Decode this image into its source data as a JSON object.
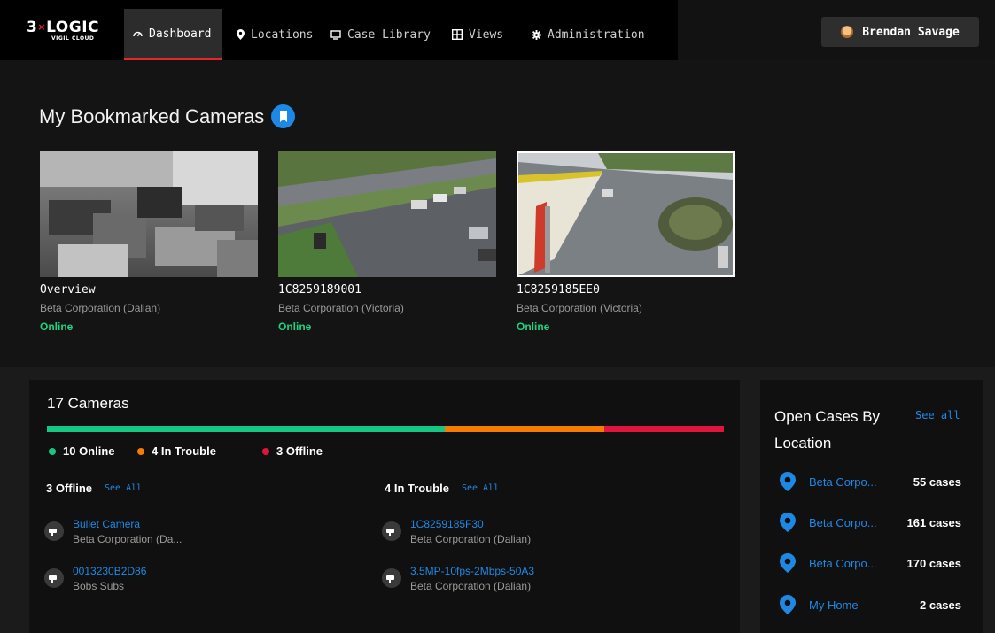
{
  "brand": {
    "logo_main": "3×LOGIC",
    "logo_sub": "VIGIL CLOUD"
  },
  "nav": {
    "items": [
      {
        "label": "Dashboard",
        "icon": "dashboard-icon",
        "active": true
      },
      {
        "label": "Locations",
        "icon": "map-pin-icon"
      },
      {
        "label": "Case Library",
        "icon": "monitor-icon"
      },
      {
        "label": "Views",
        "icon": "grid-icon"
      },
      {
        "label": "Administration",
        "icon": "gear-icon"
      }
    ],
    "user": {
      "name": "Brendan Savage",
      "icon": "avatar"
    }
  },
  "bookmarks": {
    "title": "My Bookmarked Cameras",
    "icon": "bookmark-icon",
    "cameras": [
      {
        "name": "Overview",
        "location": "Beta Corporation (Dalian)",
        "status": "Online"
      },
      {
        "name": "1C8259189001",
        "location": "Beta Corporation (Victoria)",
        "status": "Online"
      },
      {
        "name": "1C8259185EE0",
        "location": "Beta Corporation (Victoria)",
        "status": "Online",
        "selected": true
      }
    ]
  },
  "cameras_summary": {
    "title": "17 Cameras",
    "status_bar": [
      {
        "status": "online",
        "count": 10,
        "color": "#16c784"
      },
      {
        "status": "in-trouble",
        "count": 4,
        "color": "#f57c00"
      },
      {
        "status": "offline",
        "count": 3,
        "color": "#e0143c"
      }
    ],
    "legend": [
      {
        "label": "10 Online",
        "color": "#16c784"
      },
      {
        "label": "4 In Trouble",
        "color": "#f57c00"
      },
      {
        "label": "3 Offline",
        "color": "#e0143c"
      }
    ],
    "offline": {
      "heading": "3 Offline",
      "see_all": "See All",
      "items": [
        {
          "name": "Bullet Camera",
          "sub": "Beta Corporation (Da..."
        },
        {
          "name": "0013230B2D86",
          "sub": "Bobs Subs"
        }
      ]
    },
    "trouble": {
      "heading": "4 In Trouble",
      "see_all": "See All",
      "items": [
        {
          "name": "1C8259185F30",
          "sub": "Beta Corporation (Dalian)"
        },
        {
          "name": "3.5MP-10fps-2Mbps-50A3",
          "sub": "Beta Corporation (Dalian)"
        }
      ]
    }
  },
  "cases": {
    "title": "Open Cases By Location",
    "see_all": "See all",
    "items": [
      {
        "name": "Beta Corpo...",
        "count": "55 cases"
      },
      {
        "name": "Beta Corpo...",
        "count": "161 cases"
      },
      {
        "name": "Beta Corpo...",
        "count": "170 cases"
      },
      {
        "name": "My Home",
        "count": "2 cases"
      }
    ]
  },
  "colors": {
    "accent": "#1e88e5",
    "online": "#1fd17e",
    "active_tab": "#e5262b"
  }
}
